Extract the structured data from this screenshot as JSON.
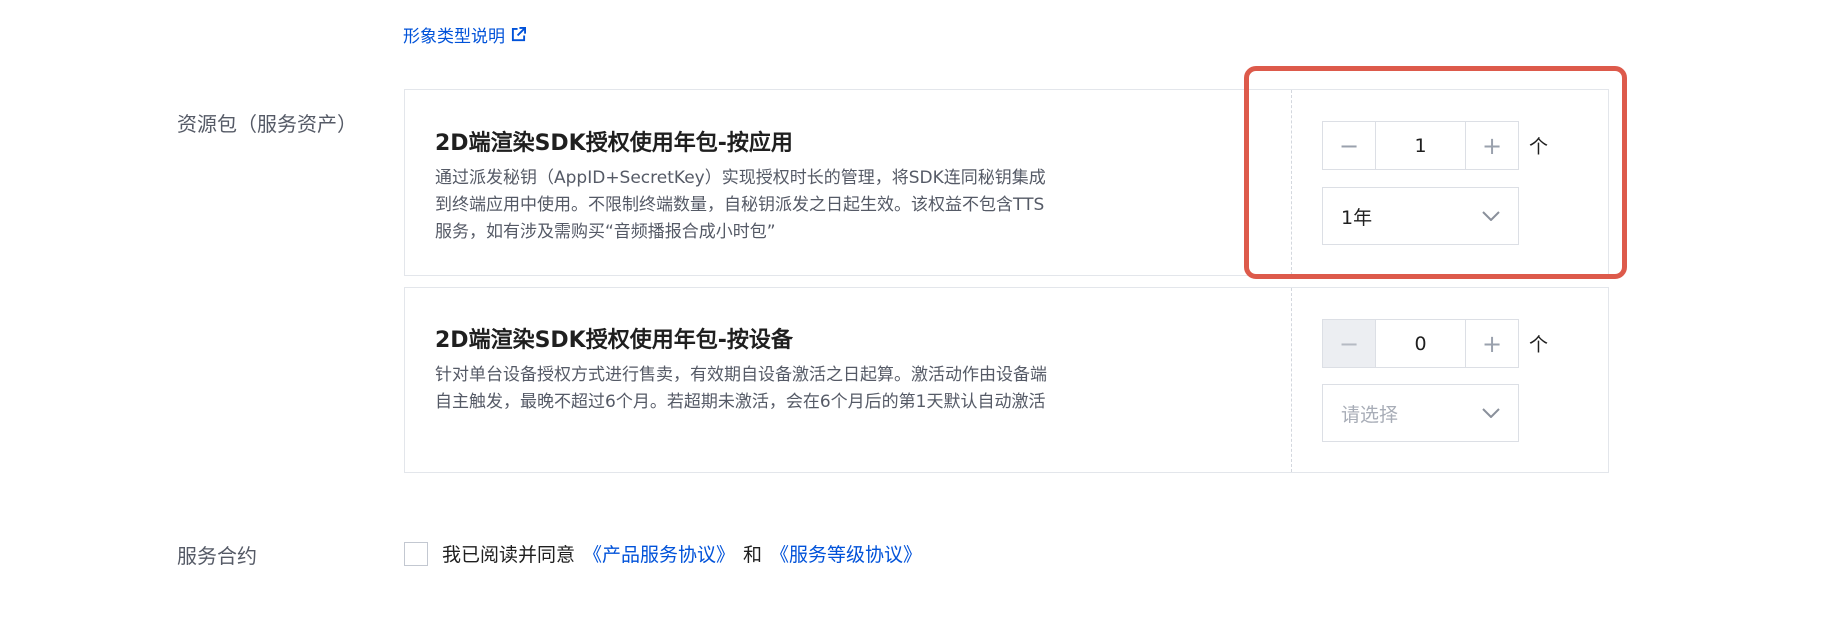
{
  "top_link": {
    "label": "形象类型说明"
  },
  "resource_label": "资源包（服务资产）",
  "packages": [
    {
      "title": "2D端渲染SDK授权使用年包-按应用",
      "desc": "通过派发秘钥（AppID+SecretKey）实现授权时长的管理，将SDK连同秘钥集成到终端应用中使用。不限制终端数量，自秘钥派发之日起生效。该权益不包含TTS服务，如有涉及需购买“音频播报合成小时包”",
      "quantity": "1",
      "unit": "个",
      "duration": "1年"
    },
    {
      "title": "2D端渲染SDK授权使用年包-按设备",
      "desc": "针对单台设备授权方式进行售卖，有效期自设备激活之日起算。激活动作由设备端自主触发，最晚不超过6个月。若超期未激活，会在6个月后的第1天默认自动激活",
      "quantity": "0",
      "unit": "个",
      "duration_placeholder": "请选择"
    }
  ],
  "stepper": {
    "minus": "−",
    "plus": "+"
  },
  "agreement": {
    "section_label": "服务合约",
    "prefix": "我已阅读并同意",
    "link1": "《产品服务协议》",
    "conj": "和",
    "link2": "《服务等级协议》"
  },
  "colors": {
    "link": "#0052d9",
    "highlight": "#dd5a4b"
  }
}
